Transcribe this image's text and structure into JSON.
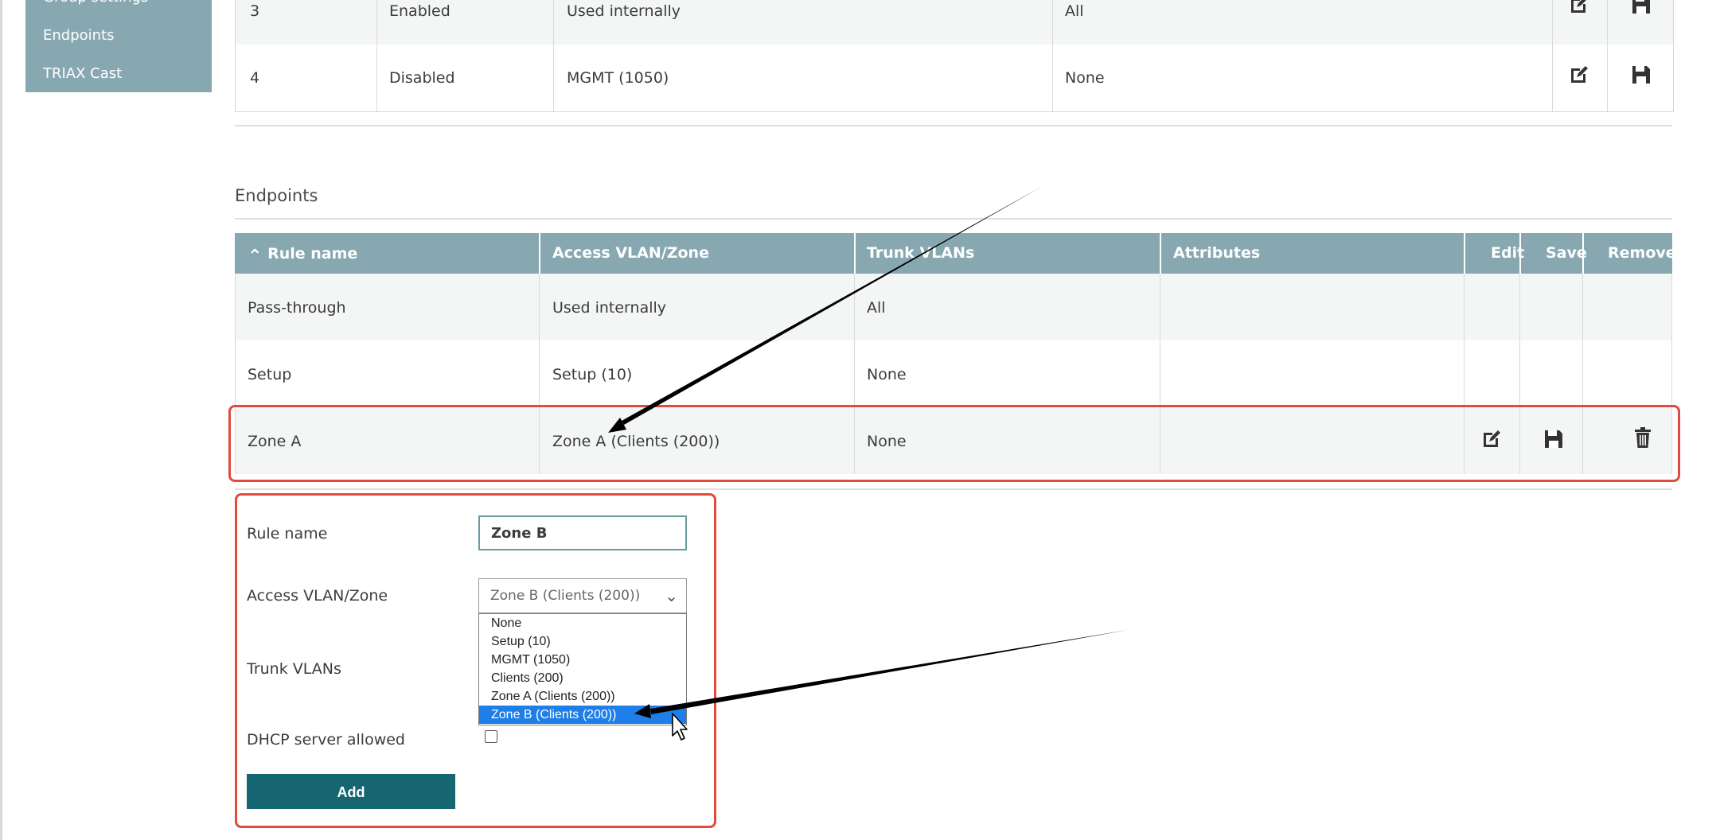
{
  "sidebar": {
    "items": [
      {
        "label": "Group settings"
      },
      {
        "label": "Endpoints"
      },
      {
        "label": "TRIAX Cast"
      }
    ]
  },
  "ports_table": {
    "rows": [
      {
        "port": "3",
        "state": "Enabled",
        "access": "Used internally",
        "trunk": "All"
      },
      {
        "port": "4",
        "state": "Disabled",
        "access": "MGMT (1050)",
        "trunk": "None"
      }
    ]
  },
  "endpoints": {
    "title": "Endpoints",
    "headers": {
      "rule_name": "Rule name",
      "access": "Access VLAN/Zone",
      "trunk": "Trunk VLANs",
      "attributes": "Attributes",
      "edit": "Edit",
      "save": "Save",
      "remove": "Remove"
    },
    "sort_indicator": "⌃",
    "rows": [
      {
        "rule_name": "Pass-through",
        "access": "Used internally",
        "trunk": "All",
        "attributes": ""
      },
      {
        "rule_name": "Setup",
        "access": "Setup (10)",
        "trunk": "None",
        "attributes": ""
      },
      {
        "rule_name": "Zone A",
        "access": "Zone A (Clients (200))",
        "trunk": "None",
        "attributes": ""
      }
    ]
  },
  "form": {
    "rule_name_label": "Rule name",
    "rule_name_value": "Zone B",
    "access_label": "Access VLAN/Zone",
    "access_selected": "Zone B (Clients (200))",
    "access_options": [
      "None",
      "Setup (10)",
      "MGMT (1050)",
      "Clients (200)",
      "Zone A (Clients (200))",
      "Zone B (Clients (200))"
    ],
    "trunk_label": "Trunk VLANs",
    "dhcp_label": "DHCP server allowed",
    "dhcp_checked": false,
    "add_label": "Add"
  },
  "icons": {
    "edit": "edit-icon",
    "save": "save-icon",
    "remove": "trash-icon",
    "chevron": "chevron-down-icon",
    "cursor": "mouse-cursor-icon"
  },
  "colors": {
    "header_bg": "#87a8b1",
    "highlight": "#de4c3c",
    "add_button": "#166672",
    "selected_option": "#1e7fe8"
  }
}
